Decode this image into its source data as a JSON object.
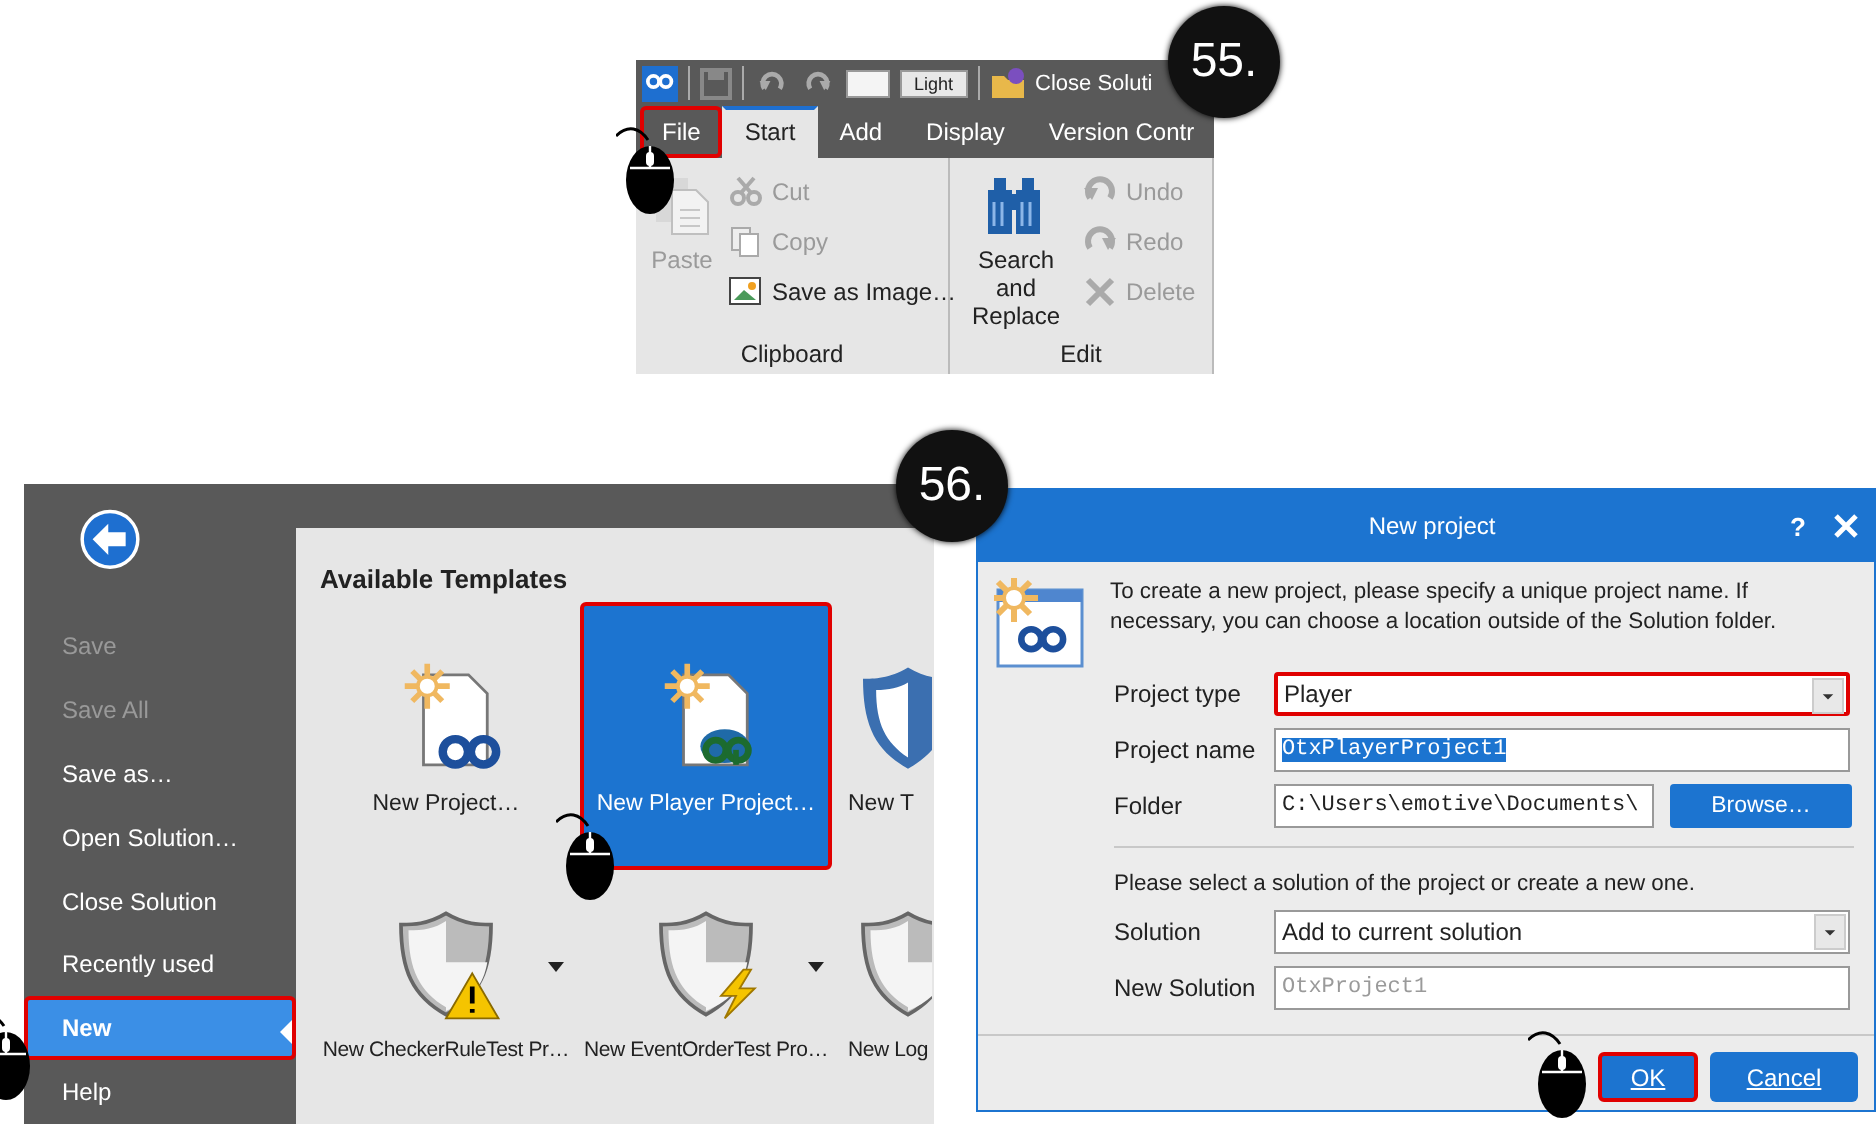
{
  "ribbon": {
    "badge": "55.",
    "quick_access": {
      "theme_label": "Light",
      "action": "Close Soluti"
    },
    "tabs": [
      {
        "label": "File",
        "selected": false,
        "highlighted": true
      },
      {
        "label": "Start",
        "selected": true,
        "highlighted": false
      },
      {
        "label": "Add",
        "selected": false,
        "highlighted": false
      },
      {
        "label": "Display",
        "selected": false,
        "highlighted": false
      },
      {
        "label": "Version Contr",
        "selected": false,
        "highlighted": false
      }
    ],
    "groups": [
      {
        "label": "Clipboard",
        "big_button": {
          "label": "Paste",
          "disabled": true
        },
        "items": [
          {
            "label": "Cut",
            "disabled": true
          },
          {
            "label": "Copy",
            "disabled": true
          },
          {
            "label": "Save as Image…",
            "disabled": false
          }
        ]
      },
      {
        "label": "Edit",
        "big_button": {
          "label": "Search and Replace",
          "disabled": false
        },
        "items": [
          {
            "label": "Undo",
            "disabled": true
          },
          {
            "label": "Redo",
            "disabled": true
          },
          {
            "label": "Delete",
            "disabled": true
          }
        ]
      }
    ]
  },
  "backstage": {
    "badge": "56.",
    "menu": [
      {
        "label": "Save",
        "disabled": true,
        "selected": false,
        "highlighted": false
      },
      {
        "label": "Save All",
        "disabled": true,
        "selected": false,
        "highlighted": false
      },
      {
        "label": "Save as…",
        "disabled": false,
        "selected": false,
        "highlighted": false
      },
      {
        "label": "Open Solution…",
        "disabled": false,
        "selected": false,
        "highlighted": false
      },
      {
        "label": "Close Solution",
        "disabled": false,
        "selected": false,
        "highlighted": false
      },
      {
        "label": "Recently used",
        "disabled": false,
        "selected": false,
        "highlighted": false
      },
      {
        "label": "New",
        "disabled": false,
        "selected": true,
        "highlighted": true
      },
      {
        "label": "Help",
        "disabled": false,
        "selected": false,
        "highlighted": false
      }
    ],
    "templates": {
      "title": "Available Templates",
      "items": [
        {
          "label": "New Project…",
          "selected": false,
          "highlighted": false,
          "dropdown": false
        },
        {
          "label": "New Player Project…",
          "selected": true,
          "highlighted": true,
          "dropdown": false
        },
        {
          "label": "New T",
          "selected": false,
          "highlighted": false,
          "dropdown": false
        },
        {
          "label": "New CheckerRuleTest Pr…",
          "selected": false,
          "highlighted": false,
          "dropdown": true
        },
        {
          "label": "New EventOrderTest Pro…",
          "selected": false,
          "highlighted": false,
          "dropdown": true
        },
        {
          "label": "New Log",
          "selected": false,
          "highlighted": false,
          "dropdown": false
        }
      ]
    }
  },
  "dialog": {
    "title": "New project",
    "help": "?",
    "intro": "To create a new project, please specify a unique project name. If necessary, you can choose a location outside of the Solution folder.",
    "fields": [
      {
        "label": "Project type",
        "kind": "dropdown",
        "value": "Player",
        "highlighted": true
      },
      {
        "label": "Project name",
        "kind": "text",
        "value": "OtxPlayerProject1",
        "text_selected": true,
        "disabled": false,
        "highlighted": false
      },
      {
        "label": "Folder",
        "kind": "browse",
        "value": "C:\\Users\\emotive\\Documents\\",
        "button": "Browse…",
        "highlighted": false
      }
    ],
    "solution_hint": "Please select a solution of the project or create a new one.",
    "solution_fields": [
      {
        "label": "Solution",
        "kind": "dropdown",
        "value": "Add to current solution",
        "highlighted": false
      },
      {
        "label": "New Solution",
        "kind": "text",
        "value": "OtxProject1",
        "text_selected": false,
        "disabled": true,
        "highlighted": false
      }
    ],
    "buttons": [
      {
        "label": "OK",
        "highlighted": true
      },
      {
        "label": "Cancel",
        "highlighted": false
      }
    ]
  }
}
